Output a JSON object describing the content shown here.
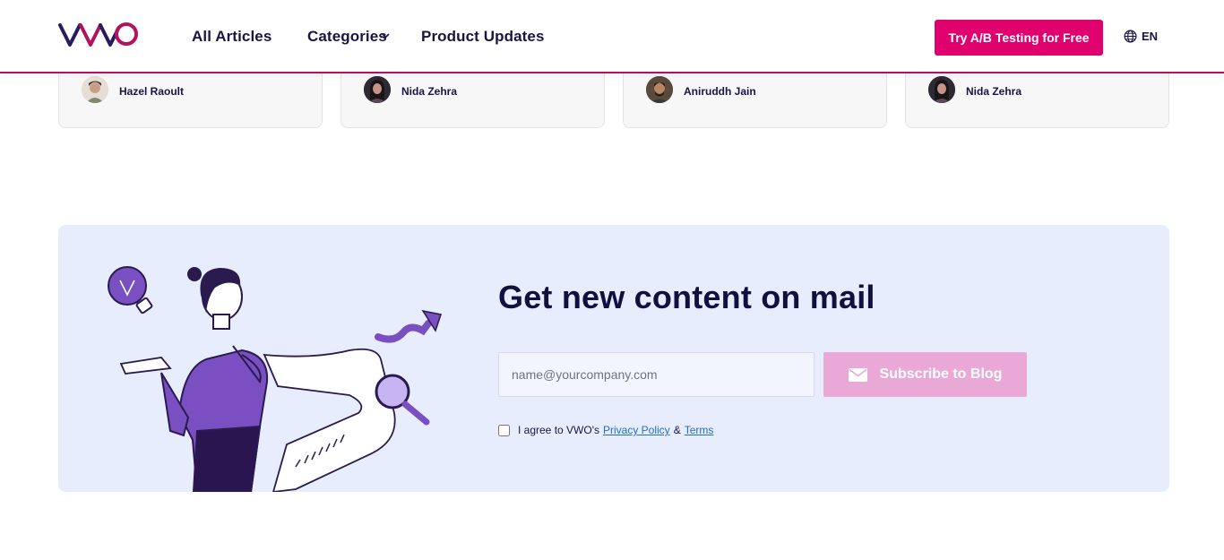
{
  "header": {
    "logo_text": "VWO",
    "nav": {
      "all_articles": "All Articles",
      "categories": "Categories",
      "product_updates": "Product Updates"
    },
    "cta_label": "Try A/B Testing for Free",
    "language": "EN"
  },
  "cards": [
    {
      "author": "Hazel Raoult"
    },
    {
      "author": "Nida Zehra"
    },
    {
      "author": "Aniruddh Jain"
    },
    {
      "author": "Nida Zehra"
    }
  ],
  "subscribe": {
    "title": "Get new content on mail",
    "email_placeholder": "name@yourcompany.com",
    "button_label": "Subscribe to Blog",
    "agree_text": "I agree to VWO's",
    "privacy_link": "Privacy Policy",
    "and_text": "&",
    "terms_link": "Terms"
  },
  "colors": {
    "brand_pink": "#e0006e",
    "brand_navy": "#1a1446",
    "panel_bg": "#e8edfd",
    "button_disabled": "#eaa8d6"
  },
  "icons": [
    "vwo-logo",
    "chevron-down-icon",
    "globe-icon",
    "mail-icon"
  ]
}
